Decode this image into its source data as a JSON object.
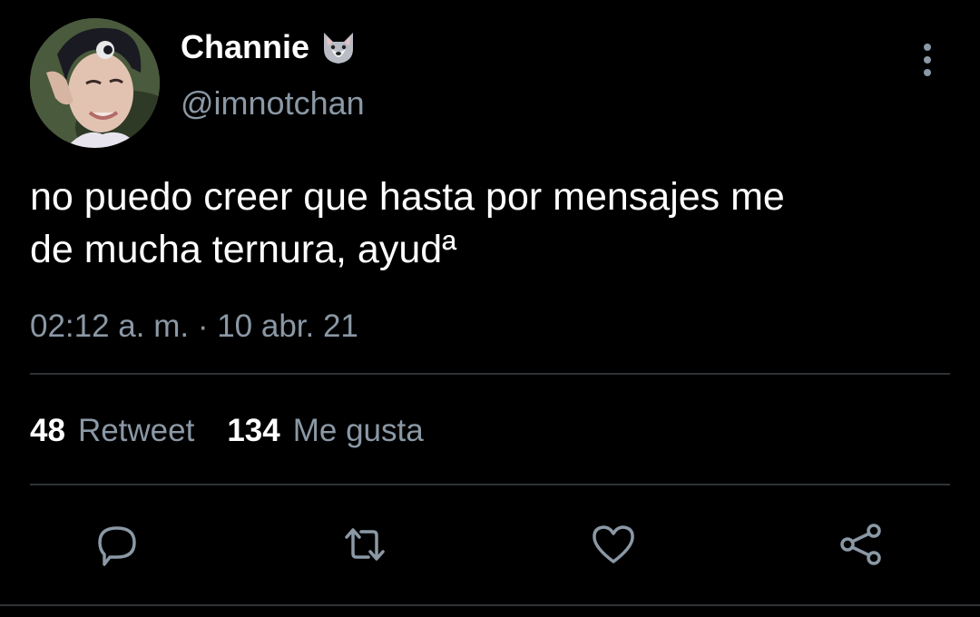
{
  "user": {
    "display_name": "Channie",
    "name_emoji_icon": "wolf-face-icon",
    "handle": "@imnotchan",
    "avatar": "profile-photo"
  },
  "tweet": {
    "text": "no puedo creer que hasta por mensajes me\nde mucha ternura, ayudª",
    "timestamp": "02:12 a. m. · 10 abr. 21"
  },
  "stats": {
    "retweets_count": "48",
    "retweets_label": "Retweet",
    "likes_count": "134",
    "likes_label": "Me gusta"
  },
  "actions": [
    {
      "name": "reply",
      "icon": "speech-bubble-icon"
    },
    {
      "name": "retweet",
      "icon": "retweet-arrows-icon"
    },
    {
      "name": "like",
      "icon": "heart-icon"
    },
    {
      "name": "share",
      "icon": "share-nodes-icon"
    }
  ],
  "colors": {
    "background": "#000000",
    "primary_text": "#ffffff",
    "secondary_text": "#8b98a5",
    "divider": "#2f3336"
  }
}
